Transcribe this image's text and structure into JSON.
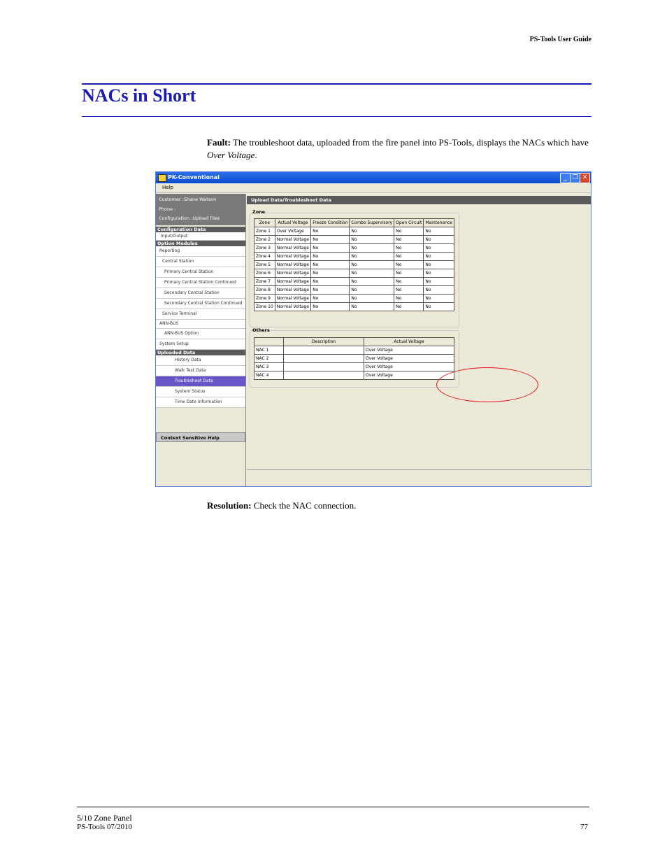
{
  "header": {
    "guide_title": "PS-Tools User Guide"
  },
  "section": {
    "title": "NACs in Short"
  },
  "fault": {
    "label": "Fault:",
    "text_before": " The troubleshoot data, uploaded from the fire panel into PS-Tools, displays the NACs which have ",
    "emphasis": "Over Voltage",
    "text_after": "."
  },
  "resolution": {
    "label": "Resolution:",
    "text": " Check the NAC connection."
  },
  "window": {
    "title": "PK-Conventional",
    "menu": [
      "Help"
    ],
    "info": {
      "customer": "Customer :Shane Watson",
      "phone": "Phone :",
      "configuration": "Configuration :Upload Files"
    },
    "nav": {
      "config_header": "Configuration Data",
      "input_output": "Input/Output",
      "option_header": "Option Modules",
      "items": [
        "Reporting",
        "Central Station",
        "Primary Central Station",
        "Primary Central Station Continued",
        "Secondary Central Station",
        "Secondary Central Station Continued",
        "Service Terminal",
        "ANN-BUS",
        "ANN-BUS Option",
        "System Setup"
      ],
      "uploaded_header": "Uploaded Data",
      "uploaded_items": [
        "History Data",
        "Walk Test Data",
        "Troubleshoot Data",
        "System Status",
        "Time Date Information"
      ],
      "context_help": "Context Sensitive Help"
    },
    "panel_title": "Upload Data/Troubleshoot Data",
    "zone_group": "Zone",
    "zone_headers": [
      "Zone",
      "Actual Voltage",
      "Freeze Condition",
      "Combo Supervisory",
      "Open Circuit",
      "Maintenance"
    ],
    "zone_rows": [
      [
        "Zone 1",
        "Over Voltage",
        "No",
        "No",
        "No",
        "No"
      ],
      [
        "Zone 2",
        "Normal Voltage",
        "No",
        "No",
        "No",
        "No"
      ],
      [
        "Zone 3",
        "Normal Voltage",
        "No",
        "No",
        "No",
        "No"
      ],
      [
        "Zone 4",
        "Normal Voltage",
        "No",
        "No",
        "No",
        "No"
      ],
      [
        "Zone 5",
        "Normal Voltage",
        "No",
        "No",
        "No",
        "No"
      ],
      [
        "Zone 6",
        "Normal Voltage",
        "No",
        "No",
        "No",
        "No"
      ],
      [
        "Zone 7",
        "Normal Voltage",
        "No",
        "No",
        "No",
        "No"
      ],
      [
        "Zone 8",
        "Normal Voltage",
        "No",
        "No",
        "No",
        "No"
      ],
      [
        "Zone 9",
        "Normal Voltage",
        "No",
        "No",
        "No",
        "No"
      ],
      [
        "Zone 10",
        "Normal Voltage",
        "No",
        "No",
        "No",
        "No"
      ]
    ],
    "others_group": "Others",
    "others_headers": [
      "",
      "Description",
      "Actual Voltage"
    ],
    "others_rows": [
      [
        "NAC 1",
        "",
        "Over Voltage"
      ],
      [
        "NAC 2",
        "",
        "Over Voltage"
      ],
      [
        "NAC 3",
        "",
        "Over Voltage"
      ],
      [
        "NAC 4",
        "",
        "Over Voltage"
      ]
    ]
  },
  "footer": {
    "line1": "5/10 Zone Panel",
    "line2": "PS-Tools 07/2010",
    "page": "77"
  }
}
